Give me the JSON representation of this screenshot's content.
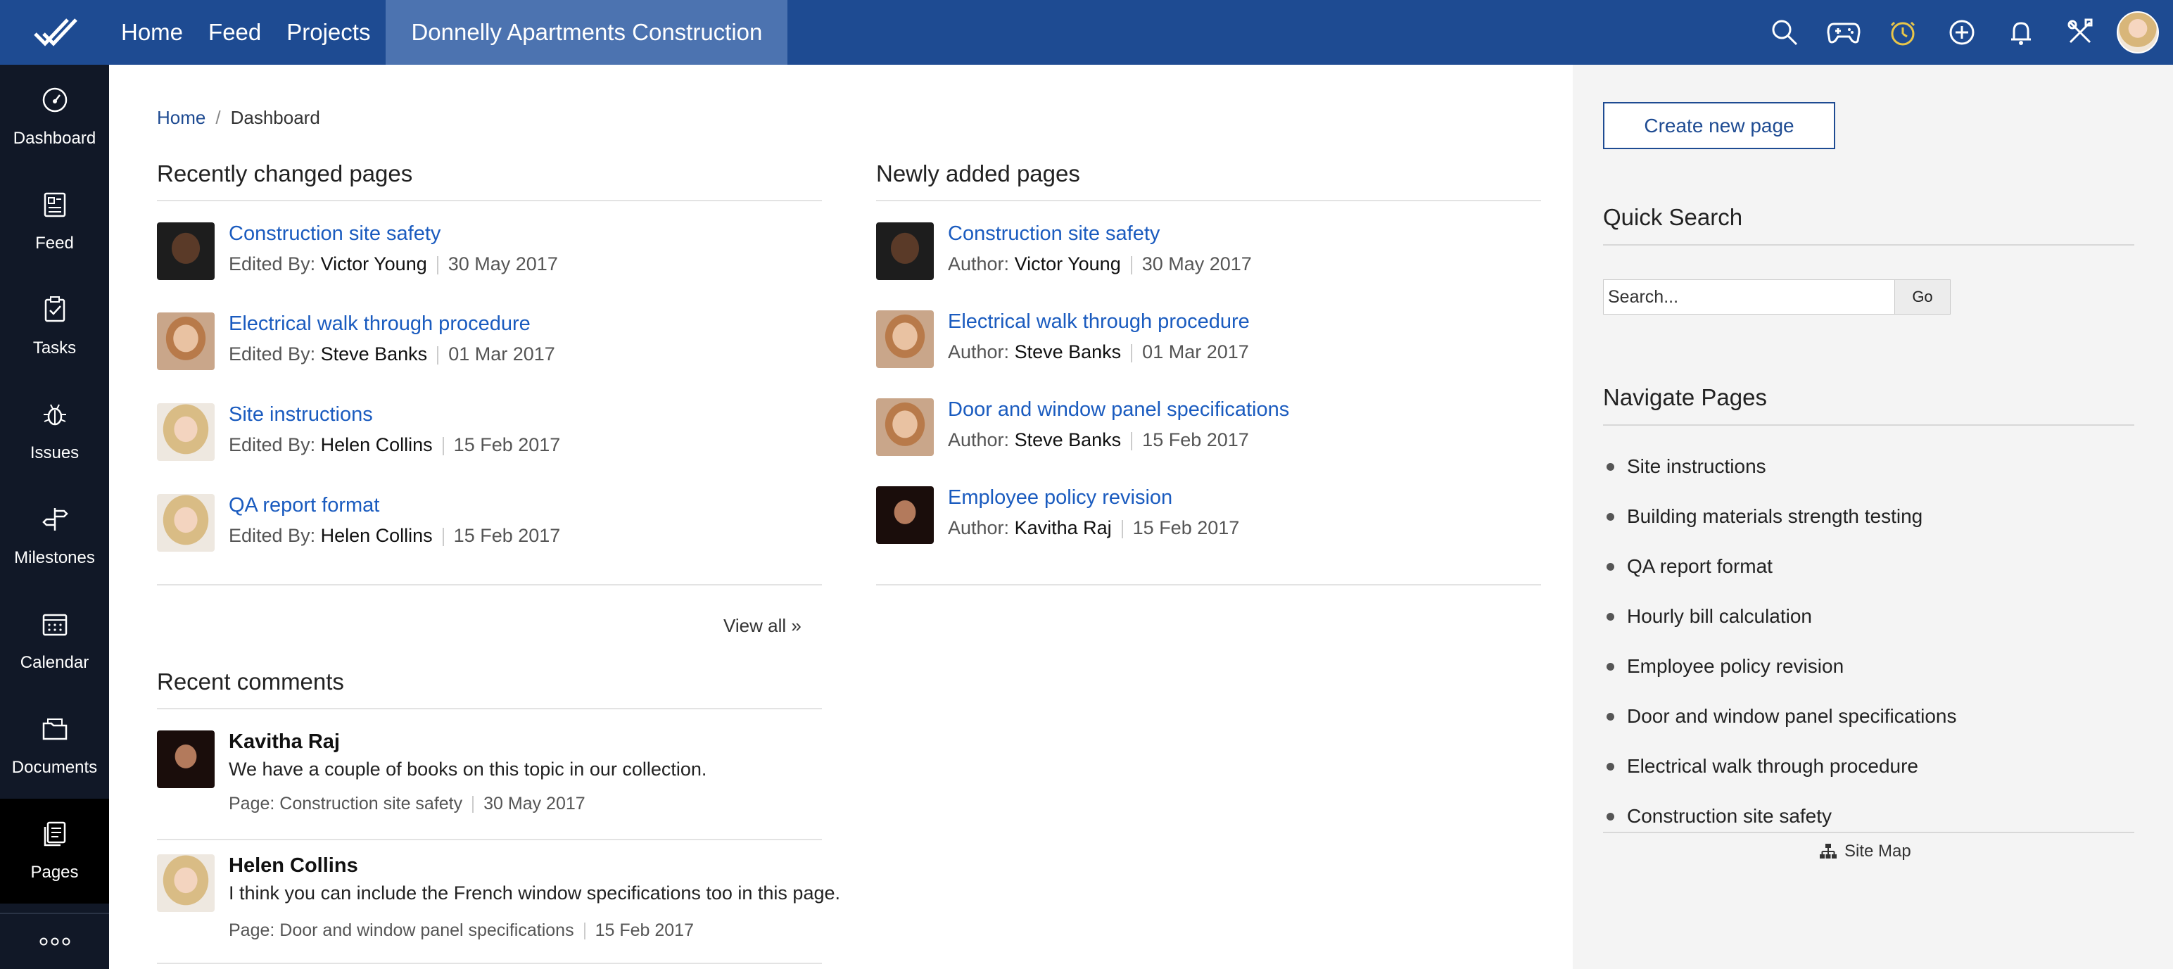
{
  "topbar": {
    "nav": [
      "Home",
      "Feed",
      "Projects"
    ],
    "project": "Donnelly Apartments Construction",
    "icons": [
      "search-icon",
      "gamepad-icon",
      "timer-icon",
      "add-icon",
      "bell-icon",
      "tools-icon"
    ],
    "accent": "#1e4b92"
  },
  "sidebar": {
    "items": [
      {
        "label": "Dashboard",
        "icon": "gauge-icon"
      },
      {
        "label": "Feed",
        "icon": "feed-icon"
      },
      {
        "label": "Tasks",
        "icon": "clipboard-icon"
      },
      {
        "label": "Issues",
        "icon": "bug-icon"
      },
      {
        "label": "Milestones",
        "icon": "signpost-icon"
      },
      {
        "label": "Calendar",
        "icon": "calendar-icon"
      },
      {
        "label": "Documents",
        "icon": "folder-icon"
      },
      {
        "label": "Pages",
        "icon": "pages-icon"
      }
    ],
    "more": "more-icon"
  },
  "breadcrumb": {
    "home": "Home",
    "sep": "/",
    "current": "Dashboard"
  },
  "recent": {
    "title": "Recently changed pages",
    "label": "Edited By:",
    "items": [
      {
        "title": "Construction site safety",
        "who": "Victor Young",
        "date": "30 May 2017"
      },
      {
        "title": "Electrical walk through procedure",
        "who": "Steve Banks",
        "date": "01 Mar 2017"
      },
      {
        "title": "Site instructions",
        "who": "Helen Collins",
        "date": "15 Feb 2017"
      },
      {
        "title": "QA report format",
        "who": "Helen Collins",
        "date": "15 Feb 2017"
      }
    ],
    "view_all": "View all »"
  },
  "newly": {
    "title": "Newly added pages",
    "label": "Author:",
    "items": [
      {
        "title": "Construction site safety",
        "who": "Victor Young",
        "date": "30 May 2017"
      },
      {
        "title": "Electrical walk through procedure",
        "who": "Steve Banks",
        "date": "01 Mar 2017"
      },
      {
        "title": "Door and window panel specifications",
        "who": "Steve Banks",
        "date": "15 Feb 2017"
      },
      {
        "title": "Employee policy revision",
        "who": "Kavitha Raj",
        "date": "15 Feb 2017"
      }
    ]
  },
  "comments": {
    "title": "Recent comments",
    "items": [
      {
        "name": "Kavitha Raj",
        "text": "We have a couple of books on this topic in our collection.",
        "page": "Page: Construction site safety",
        "date": "30 May 2017"
      },
      {
        "name": "Helen Collins",
        "text": "I think you can include the French window specifications too in this page.",
        "page": "Page: Door and window panel specifications",
        "date": "15 Feb 2017"
      }
    ]
  },
  "right": {
    "create": "Create new page",
    "quick_search": "Quick Search",
    "search_placeholder": "Search...",
    "go": "Go",
    "navigate": "Navigate Pages",
    "pages": [
      "Site instructions",
      "Building materials strength testing",
      "QA report format",
      "Hourly bill calculation",
      "Employee policy revision",
      "Door and window panel specifications",
      "Electrical walk through procedure",
      "Construction site safety"
    ],
    "sitemap": "Site Map"
  }
}
